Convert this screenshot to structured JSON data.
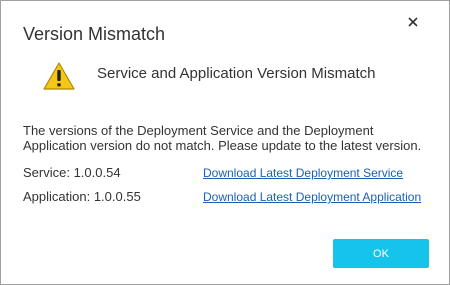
{
  "dialog": {
    "title": "Version Mismatch",
    "subtitle": "Service and Application Version Mismatch",
    "message": "The versions of the Deployment Service and the Deployment Application version do not match. Please update to the latest version.",
    "rows": [
      {
        "label": "Service: 1.0.0.54",
        "link": "Download Latest Deployment Service"
      },
      {
        "label": "Application: 1.0.0.55",
        "link": "Download Latest Deployment Application"
      }
    ],
    "ok_label": "OK",
    "icons": {
      "close": "close-icon",
      "warning": "warning-icon"
    }
  },
  "colors": {
    "accent": "#16c3ea",
    "link": "#1a5fb4",
    "warning_fill": "#f5c518",
    "text": "#333333"
  }
}
